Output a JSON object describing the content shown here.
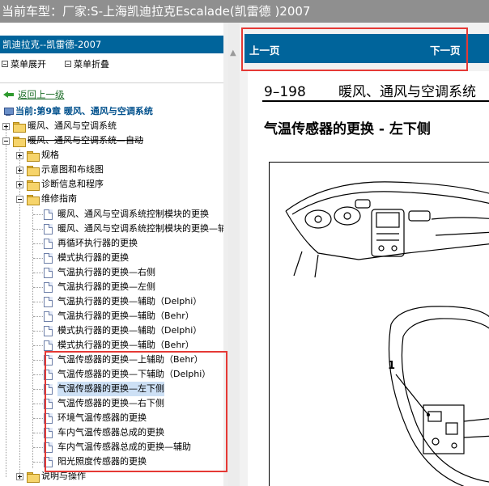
{
  "window": {
    "title": "当前车型：厂家:S-上海凯迪拉克Escalade(凯雷德 )2007"
  },
  "tree_panel": {
    "header": "凯迪拉克--凯雷德-2007",
    "expand_label": "菜单展开",
    "collapse_label": "菜单折叠",
    "back_label": "返回上一级",
    "current_label": "当前:第9章 暖风、通风与空调系统",
    "items": [
      {
        "label": "暖风、通风与空调系统"
      },
      {
        "label": "暖风、通风与空调系统—自动"
      },
      {
        "label": "规格"
      },
      {
        "label": "示意图和布线图"
      },
      {
        "label": "诊断信息和程序"
      },
      {
        "label": "维修指南"
      },
      {
        "label": "暖风、通风与空调系统控制模块的更换"
      },
      {
        "label": "暖风、通风与空调系统控制模块的更换—辅"
      },
      {
        "label": "再循环执行器的更换"
      },
      {
        "label": "模式执行器的更换"
      },
      {
        "label": "气温执行器的更换—右侧"
      },
      {
        "label": "气温执行器的更换—左侧"
      },
      {
        "label": "气温执行器的更换—辅助（Delphi）"
      },
      {
        "label": "气温执行器的更换—辅助（Behr）"
      },
      {
        "label": "模式执行器的更换—辅助（Delphi）"
      },
      {
        "label": "模式执行器的更换—辅助（Behr）"
      },
      {
        "label": "气温传感器的更换—上辅助（Behr）"
      },
      {
        "label": "气温传感器的更换—下辅助（Delphi）"
      },
      {
        "label": "气温传感器的更换—左下侧"
      },
      {
        "label": "气温传感器的更换—右下侧"
      },
      {
        "label": "环境气温传感器的更换"
      },
      {
        "label": "车内气温传感器总成的更换"
      },
      {
        "label": "车内气温传感器总成的更换—辅助"
      },
      {
        "label": "阳光照度传感器的更换"
      },
      {
        "label": "说明与操作"
      }
    ]
  },
  "nav": {
    "prev_label": "上一页",
    "next_label": "下一页"
  },
  "document": {
    "page_number": "9–198",
    "section_title": "暖风、通风与空调系统",
    "heading": "气温传感器的更换 - 左下侧",
    "figure_callout": "1"
  },
  "colors": {
    "header_blue": "#00649b",
    "title_bar_gray": "#8f8f8f",
    "highlight_red": "#e53935",
    "selected_bg": "#cde0f5"
  }
}
